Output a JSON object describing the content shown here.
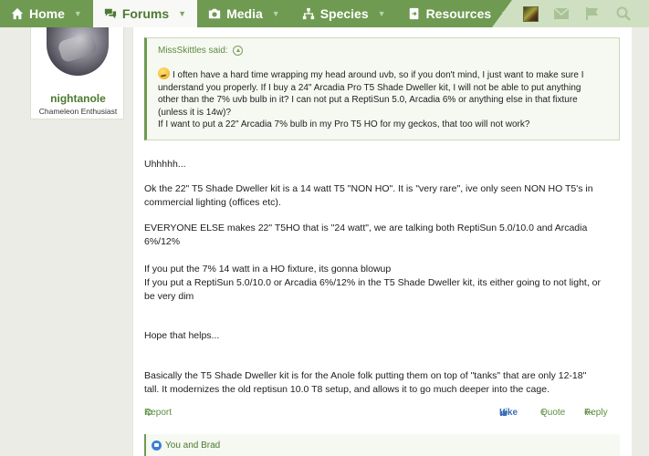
{
  "nav": {
    "tabs": [
      {
        "label": "Home",
        "icon": "home-icon"
      },
      {
        "label": "Forums",
        "icon": "forums-icon",
        "active": true
      },
      {
        "label": "Media",
        "icon": "camera-icon"
      },
      {
        "label": "Species",
        "icon": "species-icon"
      },
      {
        "label": "Resources",
        "icon": "resources-icon"
      }
    ],
    "more_icon": "pencil-icon",
    "scroll_icon": "chevron-right-icon",
    "right_icons": [
      "user-avatar",
      "mail-icon",
      "flag-icon",
      "search-icon"
    ]
  },
  "user": {
    "name": "nightanole",
    "title": "Chameleon Enthusiast"
  },
  "quote": {
    "author_line": "MissSkittles said:",
    "lines": [
      "I often have a hard time wrapping my head around uvb, so if you don't mind, I just want to make sure I",
      "understand you properly. If I buy a 24\" Arcadia Pro T5 Shade Dweller kit, I will not be able to put anything",
      "other than the 7% uvb bulb in it? I can not put a ReptiSun 5.0, Arcadia 6% or anything else in that fixture",
      "(unless it is 14w)?",
      "If I want to put a 22\" Arcadia 7% bulb in my Pro T5 HO for my geckos, that too will not work?"
    ]
  },
  "post": {
    "paragraphs": [
      "Uhhhhh...",
      "Ok the 22\" T5 Shade Dweller kit is a 14 watt T5 \"NON HO\". It is \"very rare\", ive only seen NON HO T5's in",
      "commercial lighting (offices etc).",
      "EVERYONE ELSE makes 22\" T5HO that is \"24 watt\", we are talking both ReptiSun 5.0/10.0 and Arcadia",
      "6%/12%",
      "If you put the 7% 14 watt in a HO fixture, its gonna blowup",
      "If you put a ReptiSun 5.0/10.0 or Arcadia 6%/12% in the T5 Shade Dweller kit, its either going to not light, or",
      "be very dim",
      "Hope that helps...",
      "Basically the T5 Shade Dweller kit is for the Anole folk putting them on top of \"tanks\" that are only 12-18\"",
      "tall. It modernizes the old reptisun 10.0 T8 setup, and allows it to go much deeper into the cage."
    ]
  },
  "actions": {
    "report": "Report",
    "like": "Like",
    "quote": "Quote",
    "reply": "Reply"
  },
  "reactions": {
    "text": "You and Brad"
  },
  "colors": {
    "nav_green": "#6f9a52",
    "link_green": "#5c8d40",
    "like_blue": "#3b6fb6"
  }
}
